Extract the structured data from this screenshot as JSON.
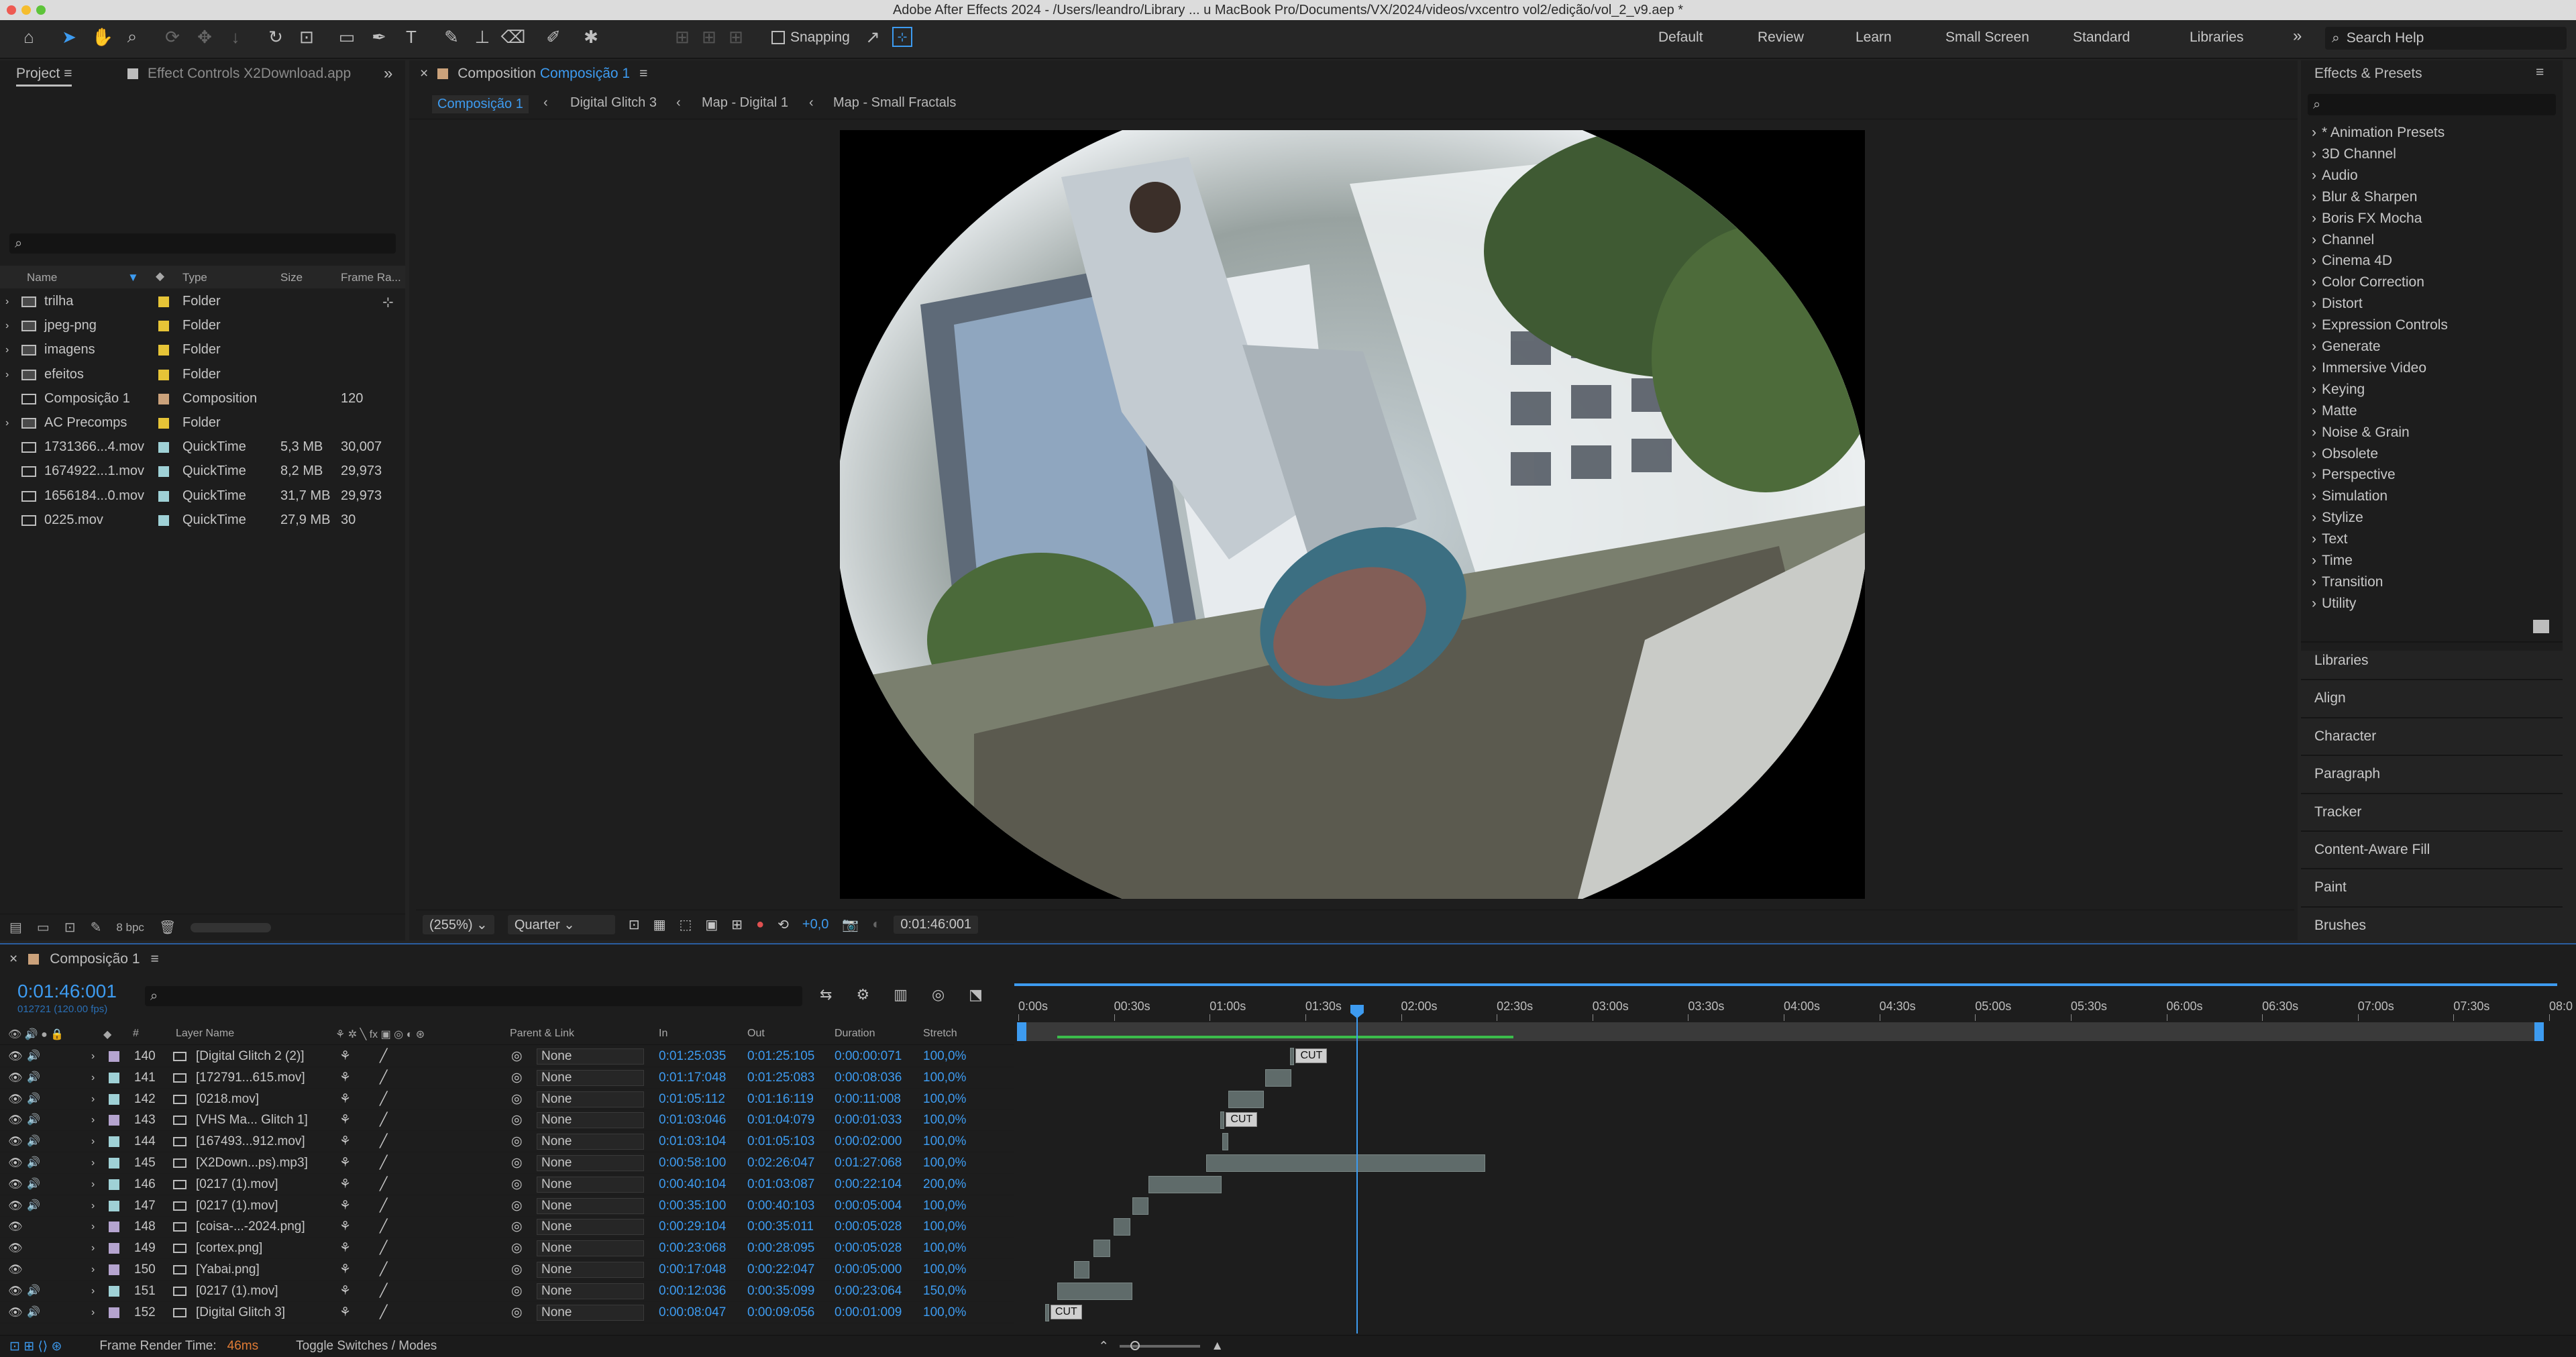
{
  "window": {
    "title": "Adobe After Effects 2024 - /Users/leandro/Library ... u MacBook Pro/Documents/VX/2024/videos/vxcentro vol2/edição/vol_2_v9.aep *"
  },
  "toolbar": {
    "snapping_label": "Snapping",
    "workspaces": [
      "Default",
      "Review",
      "Learn",
      "Small Screen",
      "Standard",
      "Libraries"
    ],
    "more_icon": "chevron-double-right",
    "search_placeholder": "Search Help"
  },
  "project": {
    "tab_project": "Project",
    "tab_effect_controls": "Effect Controls X2Download.app",
    "columns": {
      "name": "Name",
      "type": "Type",
      "size": "Size",
      "frame_rate": "Frame Ra..."
    },
    "items": [
      {
        "name": "trilha",
        "type": "Folder",
        "size": "",
        "rate": "",
        "color": "#e6c437",
        "kind": "folder"
      },
      {
        "name": "jpeg-png",
        "type": "Folder",
        "size": "",
        "rate": "",
        "color": "#e6c437",
        "kind": "folder"
      },
      {
        "name": "imagens",
        "type": "Folder",
        "size": "",
        "rate": "",
        "color": "#e6c437",
        "kind": "folder"
      },
      {
        "name": "efeitos",
        "type": "Folder",
        "size": "",
        "rate": "",
        "color": "#e6c437",
        "kind": "folder"
      },
      {
        "name": "Composição 1",
        "type": "Composition",
        "size": "",
        "rate": "120",
        "color": "#cba27b",
        "kind": "comp"
      },
      {
        "name": "AC Precomps",
        "type": "Folder",
        "size": "",
        "rate": "",
        "color": "#e6c437",
        "kind": "folder"
      },
      {
        "name": "1731366...4.mov",
        "type": "QuickTime",
        "size": "5,3 MB",
        "rate": "30,007",
        "color": "#9fd1d6",
        "kind": "file"
      },
      {
        "name": "1674922...1.mov",
        "type": "QuickTime",
        "size": "8,2 MB",
        "rate": "29,973",
        "color": "#9fd1d6",
        "kind": "file"
      },
      {
        "name": "1656184...0.mov",
        "type": "QuickTime",
        "size": "31,7 MB",
        "rate": "29,973",
        "color": "#9fd1d6",
        "kind": "file"
      },
      {
        "name": "0225.mov",
        "type": "QuickTime",
        "size": "27,9 MB",
        "rate": "30",
        "color": "#9fd1d6",
        "kind": "file"
      }
    ],
    "bpc": "8 bpc"
  },
  "composition": {
    "tab_prefix": "Composition",
    "tab_name": "Composição 1",
    "breadcrumbs": [
      "Composição 1",
      "Digital Glitch 3",
      "Map - Digital 1",
      "Map - Small Fractals"
    ],
    "zoom": "(255%)",
    "resolution": "Quarter",
    "exposure": "+0,0",
    "timecode": "0:01:46:001"
  },
  "effects_presets": {
    "title": "Effects & Presets",
    "items": [
      "* Animation Presets",
      "3D Channel",
      "Audio",
      "Blur & Sharpen",
      "Boris FX Mocha",
      "Channel",
      "Cinema 4D",
      "Color Correction",
      "Distort",
      "Expression Controls",
      "Generate",
      "Immersive Video",
      "Keying",
      "Matte",
      "Noise & Grain",
      "Obsolete",
      "Perspective",
      "Simulation",
      "Stylize",
      "Text",
      "Time",
      "Transition",
      "Utility"
    ]
  },
  "side_panels": [
    "Libraries",
    "Align",
    "Character",
    "Paragraph",
    "Tracker",
    "Content-Aware Fill",
    "Paint",
    "Brushes"
  ],
  "timeline": {
    "tab": "Composição 1",
    "current_time": "0:01:46:001",
    "frame_info": "012721 (120.00 fps)",
    "columns": {
      "num": "#",
      "layer_name": "Layer Name",
      "parent": "Parent & Link",
      "in": "In",
      "out": "Out",
      "duration": "Duration",
      "stretch": "Stretch"
    },
    "ruler": [
      "0:00s",
      "00:30s",
      "01:00s",
      "01:30s",
      "02:00s",
      "02:30s",
      "03:00s",
      "03:30s",
      "04:00s",
      "04:30s",
      "05:00s",
      "05:30s",
      "06:00s",
      "06:30s",
      "07:00s",
      "07:30s",
      "08:0"
    ],
    "playhead_seconds": 106,
    "layers": [
      {
        "num": "140",
        "name": "[Digital Glitch 2 (2)]",
        "parent": "None",
        "in": "0:01:25:035",
        "out": "0:01:25:105",
        "duration": "0:00:00:071",
        "stretch": "100,0%",
        "color": "#b5a4cf",
        "cut": true,
        "audio": true
      },
      {
        "num": "141",
        "name": "[172791...615.mov]",
        "parent": "None",
        "in": "0:01:17:048",
        "out": "0:01:25:083",
        "duration": "0:00:08:036",
        "stretch": "100,0%",
        "color": "#9fd1d6",
        "cut": false,
        "audio": true
      },
      {
        "num": "142",
        "name": "[0218.mov]",
        "parent": "None",
        "in": "0:01:05:112",
        "out": "0:01:16:119",
        "duration": "0:00:11:008",
        "stretch": "100,0%",
        "color": "#9fd1d6",
        "cut": false,
        "audio": true
      },
      {
        "num": "143",
        "name": "[VHS Ma... Glitch 1]",
        "parent": "None",
        "in": "0:01:03:046",
        "out": "0:01:04:079",
        "duration": "0:00:01:033",
        "stretch": "100,0%",
        "color": "#b5a4cf",
        "cut": true,
        "audio": true
      },
      {
        "num": "144",
        "name": "[167493...912.mov]",
        "parent": "None",
        "in": "0:01:03:104",
        "out": "0:01:05:103",
        "duration": "0:00:02:000",
        "stretch": "100,0%",
        "color": "#9fd1d6",
        "cut": false,
        "audio": true
      },
      {
        "num": "145",
        "name": "[X2Down...ps).mp3]",
        "parent": "None",
        "in": "0:00:58:100",
        "out": "0:02:26:047",
        "duration": "0:01:27:068",
        "stretch": "100,0%",
        "color": "#9fd1d6",
        "cut": false,
        "audio": true
      },
      {
        "num": "146",
        "name": "[0217 (1).mov]",
        "parent": "None",
        "in": "0:00:40:104",
        "out": "0:01:03:087",
        "duration": "0:00:22:104",
        "stretch": "200,0%",
        "color": "#9fd1d6",
        "cut": false,
        "audio": true
      },
      {
        "num": "147",
        "name": "[0217 (1).mov]",
        "parent": "None",
        "in": "0:00:35:100",
        "out": "0:00:40:103",
        "duration": "0:00:05:004",
        "stretch": "100,0%",
        "color": "#9fd1d6",
        "cut": false,
        "audio": true
      },
      {
        "num": "148",
        "name": "[coisa-...-2024.png]",
        "parent": "None",
        "in": "0:00:29:104",
        "out": "0:00:35:011",
        "duration": "0:00:05:028",
        "stretch": "100,0%",
        "color": "#b5a4cf",
        "cut": false,
        "audio": false
      },
      {
        "num": "149",
        "name": "[cortex.png]",
        "parent": "None",
        "in": "0:00:23:068",
        "out": "0:00:28:095",
        "duration": "0:00:05:028",
        "stretch": "100,0%",
        "color": "#b5a4cf",
        "cut": false,
        "audio": false
      },
      {
        "num": "150",
        "name": "[Yabai.png]",
        "parent": "None",
        "in": "0:00:17:048",
        "out": "0:00:22:047",
        "duration": "0:00:05:000",
        "stretch": "100,0%",
        "color": "#b5a4cf",
        "cut": false,
        "audio": false
      },
      {
        "num": "151",
        "name": "[0217 (1).mov]",
        "parent": "None",
        "in": "0:00:12:036",
        "out": "0:00:35:099",
        "duration": "0:00:23:064",
        "stretch": "150,0%",
        "color": "#9fd1d6",
        "cut": false,
        "audio": true
      },
      {
        "num": "152",
        "name": "[Digital Glitch 3]",
        "parent": "None",
        "in": "0:00:08:047",
        "out": "0:00:09:056",
        "duration": "0:00:01:009",
        "stretch": "100,0%",
        "color": "#b5a4cf",
        "cut": true,
        "audio": true
      }
    ],
    "cut_label": "CUT",
    "footer": {
      "render_label": "Frame Render Time:",
      "render_value": "46ms",
      "toggle": "Toggle Switches / Modes"
    }
  }
}
